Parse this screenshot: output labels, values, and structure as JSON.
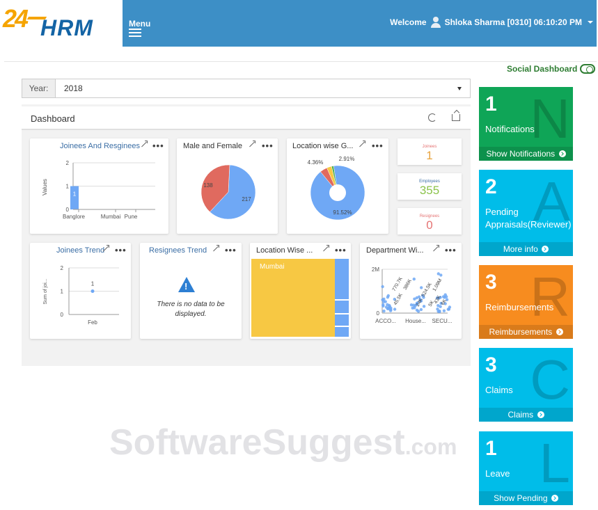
{
  "header": {
    "logo_num": "24",
    "logo_text": "HRM",
    "menu_label": "Menu",
    "welcome": "Welcome",
    "user": "Shloka Sharma [0310] 06:10:20 PM"
  },
  "social_dashboard": "Social Dashboard",
  "year": {
    "label": "Year:",
    "value": "2018"
  },
  "dashboard": {
    "title": "Dashboard"
  },
  "cards": {
    "joinees_resignees": {
      "title": "Joinees And Resginees",
      "ylabel": "Values",
      "bar_label": "1"
    },
    "male_female": {
      "title": "Male and Female"
    },
    "location_gender": {
      "title": "Location wise G..."
    },
    "joinees_trend": {
      "title": "Joinees  Trend",
      "ylabel": "Sum of joi...",
      "point_label": "1"
    },
    "resignees_trend": {
      "title": "Resignees Trend",
      "nodata": "There is no data to be displayed."
    },
    "location_wise": {
      "title": "Location Wise ...",
      "top_label": "Mumbai"
    },
    "department_wise": {
      "title": "Department Wi..."
    }
  },
  "stats": [
    {
      "label": "Joinees",
      "value": "1",
      "color": "#e8a33d"
    },
    {
      "label": "Employees",
      "value": "355",
      "color": "#8bc34a"
    },
    {
      "label": "Resignees",
      "value": "0",
      "color": "#e57373"
    }
  ],
  "tiles": [
    {
      "num": "1",
      "letter": "N",
      "title": "Notifications",
      "footer": "Show Notifications",
      "color": "#0fa557"
    },
    {
      "num": "2",
      "letter": "A",
      "title": "Pending Appraisals(Reviewer)",
      "footer": "More info",
      "color": "#00bde9"
    },
    {
      "num": "3",
      "letter": "R",
      "title": "Reimbursements",
      "footer": "Reimbursements",
      "color": "#f78c1f"
    },
    {
      "num": "3",
      "letter": "C",
      "title": "Claims",
      "footer": "Claims",
      "color": "#00bde9"
    },
    {
      "num": "1",
      "letter": "L",
      "title": "Leave",
      "footer": "Show Pending",
      "color": "#00bde9"
    }
  ],
  "watermark": {
    "main": "SoftwareSuggest",
    "suffix": ".com"
  },
  "chart_data": [
    {
      "type": "bar",
      "categories": [
        "Banglore",
        "Mumbai",
        "Pune"
      ],
      "values": [
        1,
        0,
        0
      ],
      "title": "Joinees And Resginees",
      "ylabel": "Values",
      "ylim": [
        0,
        2
      ],
      "yticks": [
        "0",
        "1",
        "2"
      ]
    },
    {
      "type": "pie",
      "title": "Male and Female",
      "values": [
        217,
        138
      ],
      "labels": [
        "217",
        "138"
      ],
      "colors": [
        "#6fa8f5",
        "#e06a5f"
      ]
    },
    {
      "type": "pie",
      "title": "Location wise G...",
      "values": [
        91.52,
        4.36,
        2.91,
        1.21
      ],
      "labels": [
        "91.52%",
        "4.36%",
        "2.91%",
        ""
      ],
      "colors": [
        "#6fa8f5",
        "#e06a5f",
        "#f7c843",
        "#4caf50"
      ]
    },
    {
      "type": "line",
      "title": "Joinees  Trend",
      "categories": [
        "Feb"
      ],
      "values": [
        1
      ],
      "ylabel": "Sum of joi...",
      "ylim": [
        0,
        2
      ],
      "yticks": [
        "0",
        "1",
        "2"
      ]
    },
    {
      "type": "heatmap",
      "title": "Location Wise ...",
      "labels": [
        "Mumbai"
      ]
    },
    {
      "type": "scatter",
      "title": "Department Wi...",
      "categories": [
        "ACCO...",
        "House...",
        "SECU..."
      ],
      "yticks": [
        "0",
        "2M"
      ],
      "point_labels": [
        "770.7K",
        "45.5K",
        "386K",
        "524.5K",
        "24K",
        "1.09M",
        "43K",
        "5K",
        "6K"
      ]
    }
  ]
}
